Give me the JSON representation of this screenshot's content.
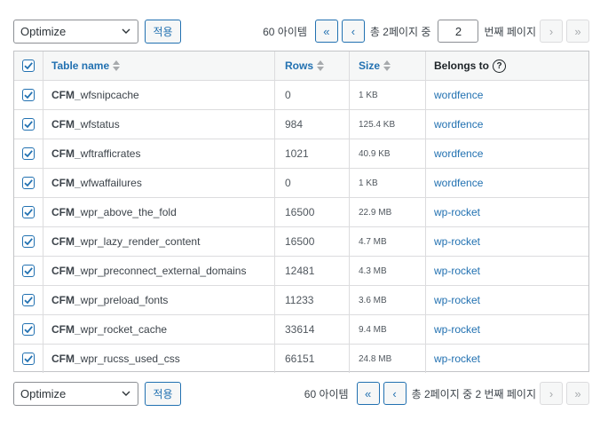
{
  "action_select": {
    "value": "Optimize"
  },
  "apply_label": "적용",
  "pagination_top": {
    "count": "60 아이템",
    "first": "«",
    "prev": "‹",
    "total_prefix": "총 2페이지 중",
    "current_page": "2",
    "page_suffix": "번째 페이지",
    "next": "›",
    "last": "»"
  },
  "pagination_bottom": {
    "count": "60 아이템",
    "first": "«",
    "prev": "‹",
    "page_text": "총 2페이지 중 2 번째 페이지",
    "next": "›",
    "last": "»"
  },
  "columns": {
    "name": "Table name",
    "rows": "Rows",
    "size": "Size",
    "belongs": "Belongs to",
    "help": "?"
  },
  "rows": [
    {
      "prefix": "CFM_",
      "name": "wfsnipcache",
      "rows": "0",
      "size": "1 KB",
      "belongs": "wordfence"
    },
    {
      "prefix": "CFM_",
      "name": "wfstatus",
      "rows": "984",
      "size": "125.4 KB",
      "belongs": "wordfence"
    },
    {
      "prefix": "CFM_",
      "name": "wftrafficrates",
      "rows": "1021",
      "size": "40.9 KB",
      "belongs": "wordfence"
    },
    {
      "prefix": "CFM_",
      "name": "wfwaffailures",
      "rows": "0",
      "size": "1 KB",
      "belongs": "wordfence"
    },
    {
      "prefix": "CFM_",
      "name": "wpr_above_the_fold",
      "rows": "16500",
      "size": "22.9 MB",
      "belongs": "wp-rocket"
    },
    {
      "prefix": "CFM_",
      "name": "wpr_lazy_render_content",
      "rows": "16500",
      "size": "4.7 MB",
      "belongs": "wp-rocket"
    },
    {
      "prefix": "CFM_",
      "name": "wpr_preconnect_external_domains",
      "rows": "12481",
      "size": "4.3 MB",
      "belongs": "wp-rocket"
    },
    {
      "prefix": "CFM_",
      "name": "wpr_preload_fonts",
      "rows": "11233",
      "size": "3.6 MB",
      "belongs": "wp-rocket"
    },
    {
      "prefix": "CFM_",
      "name": "wpr_rocket_cache",
      "rows": "33614",
      "size": "9.4 MB",
      "belongs": "wp-rocket"
    },
    {
      "prefix": "CFM_",
      "name": "wpr_rucss_used_css",
      "rows": "66151",
      "size": "24.8 MB",
      "belongs": "wp-rocket"
    }
  ],
  "colors": {
    "accent": "#2271b1",
    "border": "#c3c4c7",
    "header_bg": "#f6f7f7"
  }
}
